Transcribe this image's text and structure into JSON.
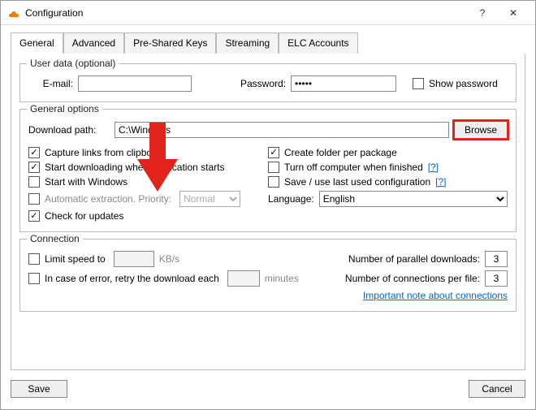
{
  "window": {
    "title": "Configuration",
    "help": "?",
    "close": "✕"
  },
  "tabs": {
    "general": "General",
    "advanced": "Advanced",
    "preshared": "Pre-Shared Keys",
    "streaming": "Streaming",
    "elc": "ELC Accounts"
  },
  "userdata": {
    "legend": "User data (optional)",
    "email_label": "E-mail:",
    "email_value": "",
    "password_label": "Password:",
    "password_value": "•••••",
    "show_password_label": "Show password"
  },
  "general_options": {
    "legend": "General options",
    "download_path_label": "Download path:",
    "download_path_value": "C:\\Windows",
    "browse_label": "Browse",
    "capture_links": "Capture links from clipboard",
    "start_downloading": "Start downloading when application starts",
    "start_windows": "Start with Windows",
    "auto_extract": "Automatic extraction. Priority:",
    "priority_value": "Normal",
    "check_updates": "Check for updates",
    "create_folder": "Create folder per package",
    "turnoff": "Turn off computer when finished",
    "saveconfig": "Save / use last used configuration",
    "language_label": "Language:",
    "language_value": "English",
    "help_q": "[?]"
  },
  "connection": {
    "legend": "Connection",
    "limit_speed": "Limit speed to",
    "kbs": "KB/s",
    "retry": "In case of error, retry the download each",
    "minutes": "minutes",
    "parallel_label": "Number of parallel downloads:",
    "parallel_value": "3",
    "perfile_label": "Number of connections per file:",
    "perfile_value": "3",
    "note": "Important note about connections"
  },
  "buttons": {
    "save": "Save",
    "cancel": "Cancel"
  }
}
